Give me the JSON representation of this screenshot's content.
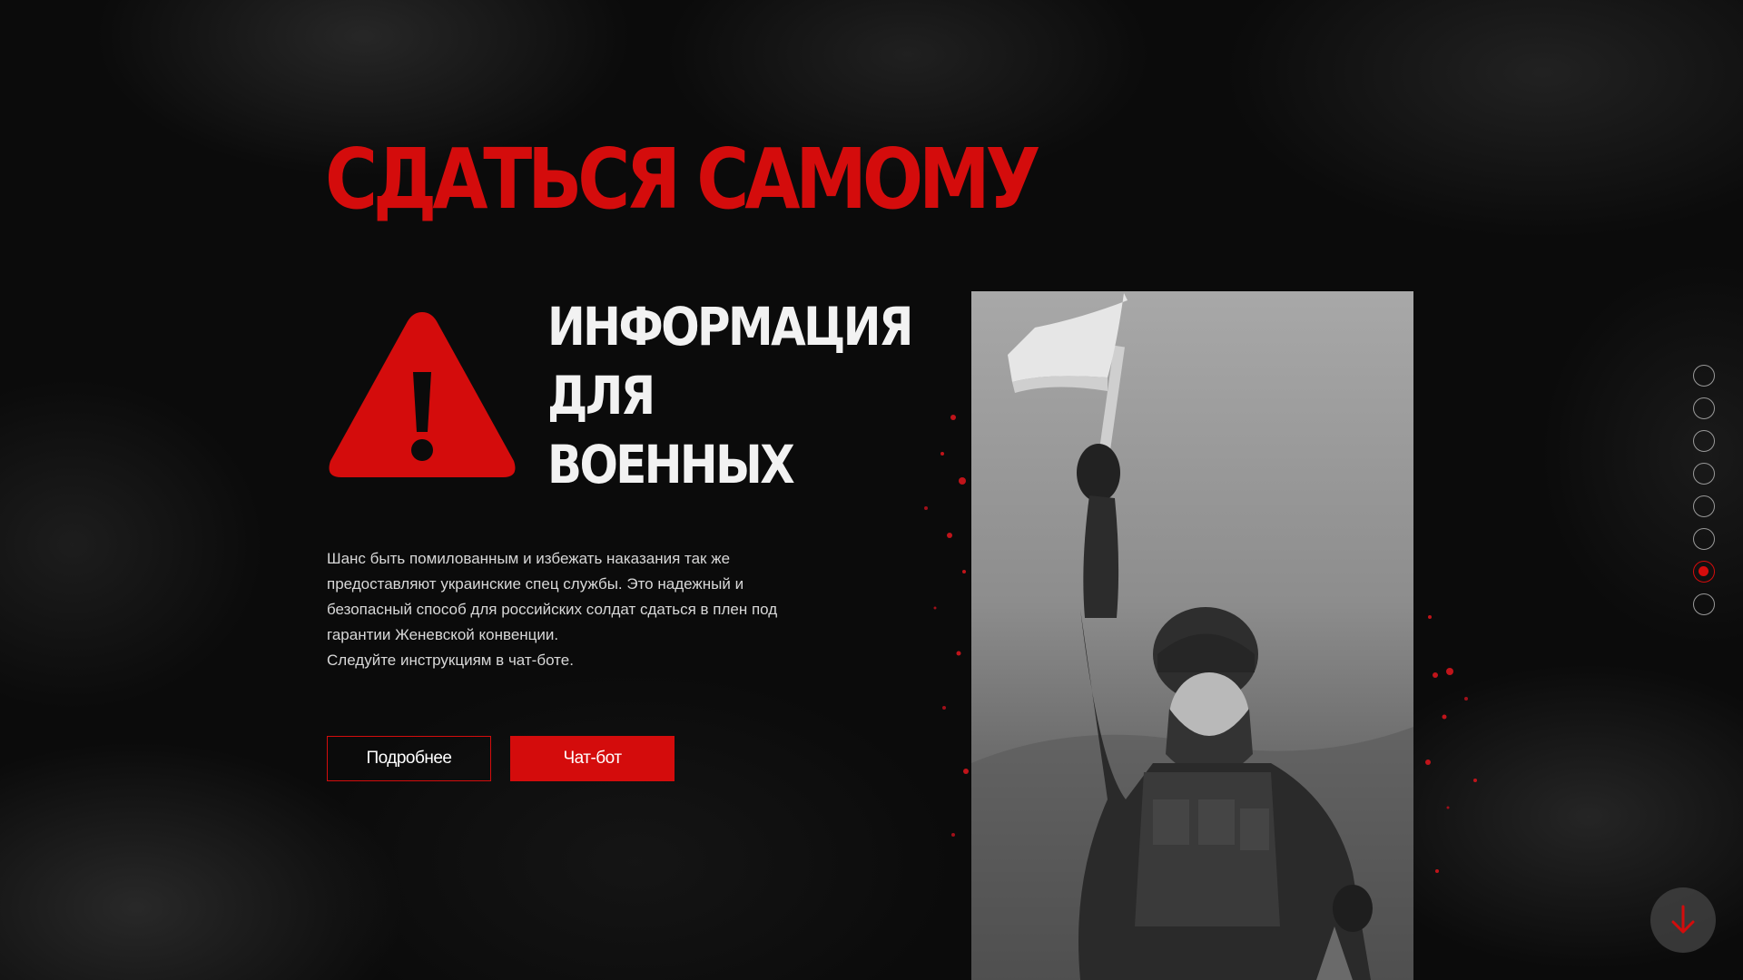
{
  "hero": {
    "title": "СДАТЬСЯ САМОМУ",
    "subtitle_lines": [
      "ИНФОРМАЦИЯ",
      "ДЛЯ",
      "ВОЕННЫХ"
    ],
    "description_lines": [
      "Шанс быть помилованным и избежать наказания так же",
      "предоставляют украинские спец службы. Это надежный и",
      "безопасный способ для российских солдат сдаться в плен под",
      "гарантии Женевской конвенции.",
      "Следуйте инструкциям в чат-боте."
    ]
  },
  "buttons": {
    "more_label": "Подробнее",
    "chatbot_label": "Чат-бот"
  },
  "icons": {
    "warning": "warning-triangle-icon",
    "scroll": "arrow-down-icon"
  },
  "photo": {
    "subject": "soldier raising white flag"
  },
  "pagination": {
    "total": 8,
    "active_index": 7
  },
  "colors": {
    "accent": "#d40c0c",
    "background": "#0b0b0b",
    "text_light": "#f2f2f2"
  }
}
